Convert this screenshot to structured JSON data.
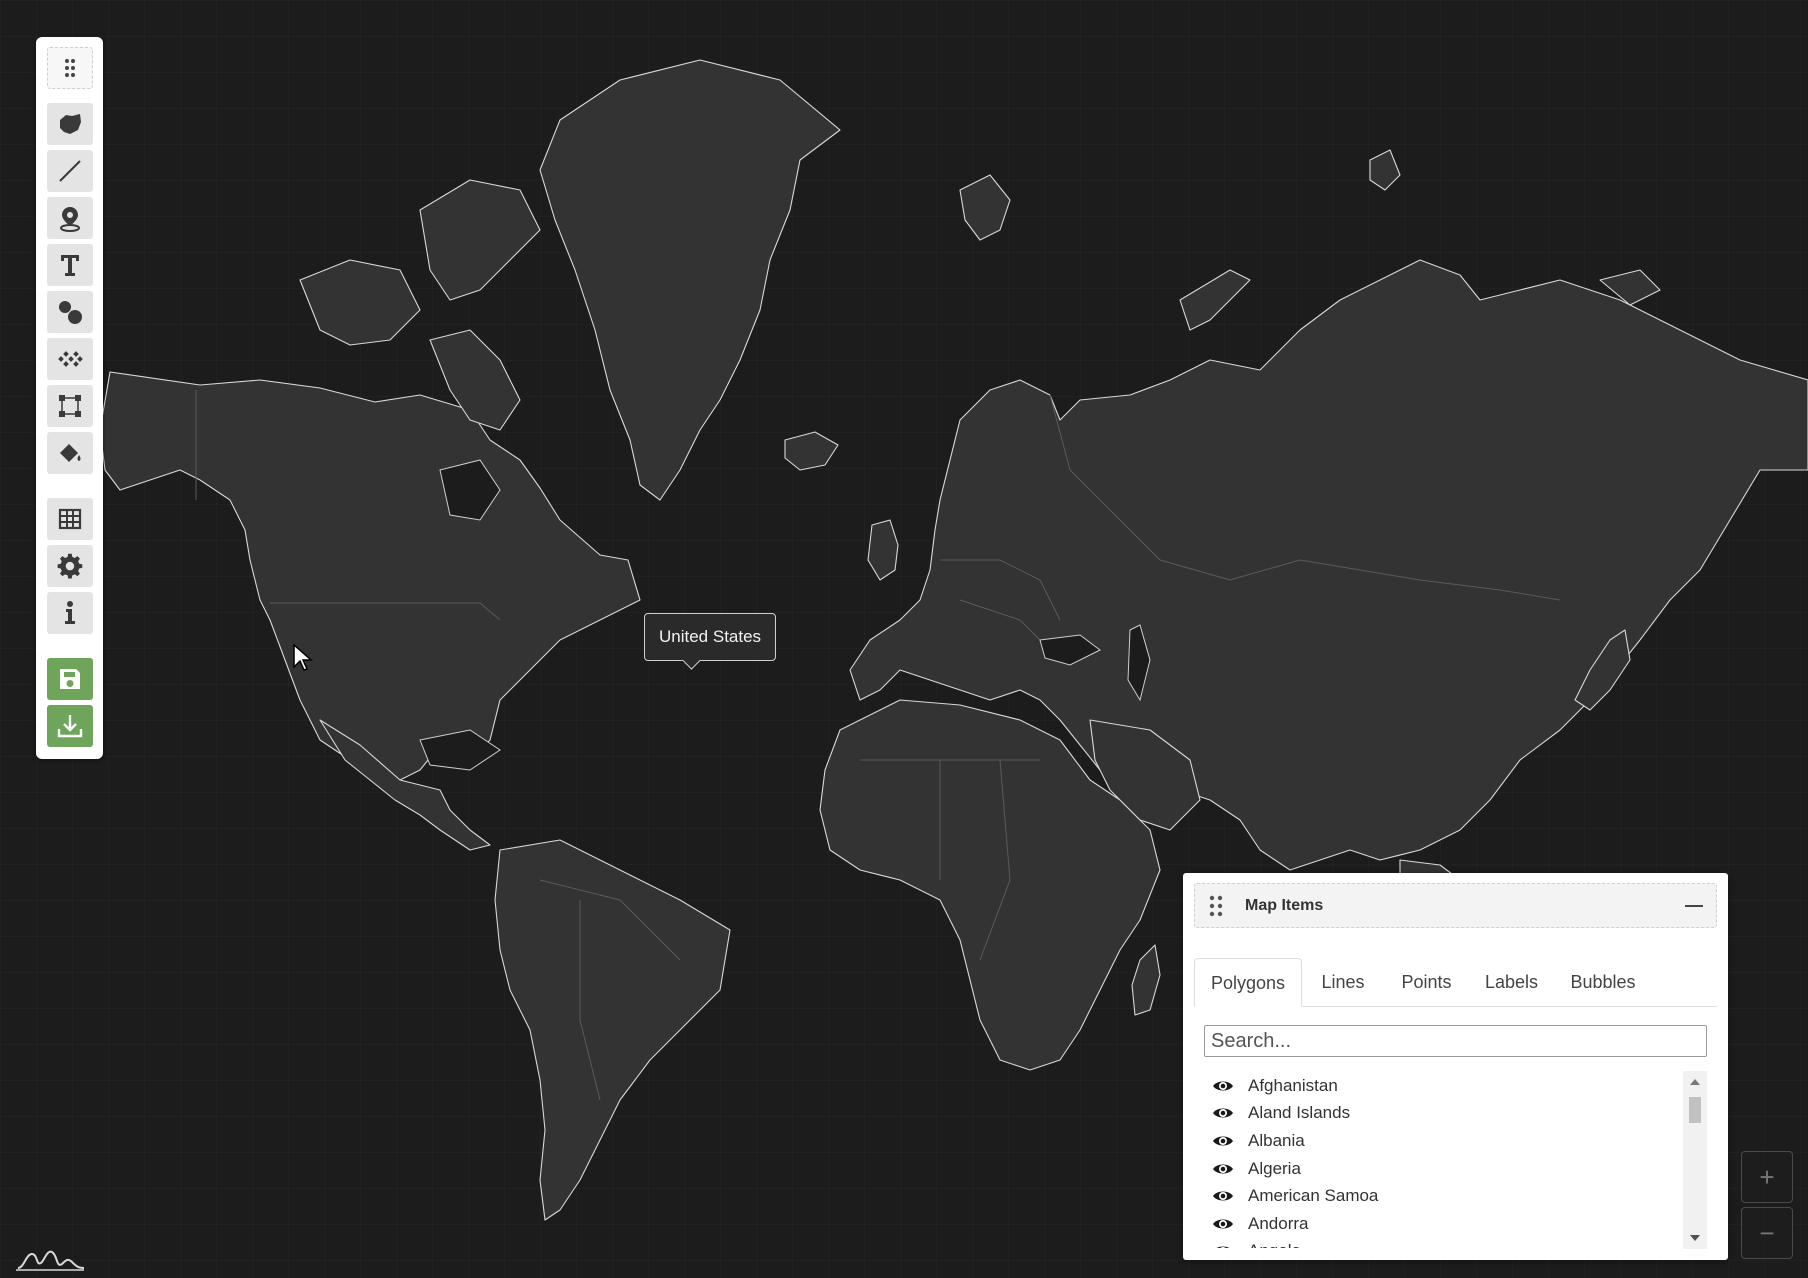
{
  "tooltip": {
    "text": "United States"
  },
  "toolbar": {
    "items": [
      {
        "name": "drag-handle",
        "icon": "grip-icon"
      },
      {
        "name": "polygon-tool",
        "icon": "polygon-icon"
      },
      {
        "name": "line-tool",
        "icon": "line-icon"
      },
      {
        "name": "point-tool",
        "icon": "map-pin-icon"
      },
      {
        "name": "text-tool",
        "icon": "text-icon"
      },
      {
        "name": "bubble-tool",
        "icon": "bubbles-icon"
      },
      {
        "name": "pattern-tool",
        "icon": "pattern-icon"
      },
      {
        "name": "select-tool",
        "icon": "selection-icon"
      },
      {
        "name": "fill-tool",
        "icon": "paint-bucket-icon"
      },
      {
        "name": "table-button",
        "icon": "table-icon"
      },
      {
        "name": "settings-button",
        "icon": "gear-icon"
      },
      {
        "name": "info-button",
        "icon": "info-icon"
      },
      {
        "name": "save-button",
        "icon": "save-icon"
      },
      {
        "name": "download-button",
        "icon": "download-icon"
      }
    ]
  },
  "panel": {
    "title": "Map Items",
    "tabs": [
      "Polygons",
      "Lines",
      "Points",
      "Labels",
      "Bubbles"
    ],
    "active_tab": "Polygons",
    "search_placeholder": "Search...",
    "items": [
      "Afghanistan",
      "Aland Islands",
      "Albania",
      "Algeria",
      "American Samoa",
      "Andorra",
      "Angola"
    ]
  },
  "zoom": {
    "in_label": "+",
    "out_label": "−"
  },
  "colors": {
    "background": "#1c1c1c",
    "land": "#333333",
    "coastline": "#d8d8d8",
    "accent_green": "#6fa55a"
  }
}
